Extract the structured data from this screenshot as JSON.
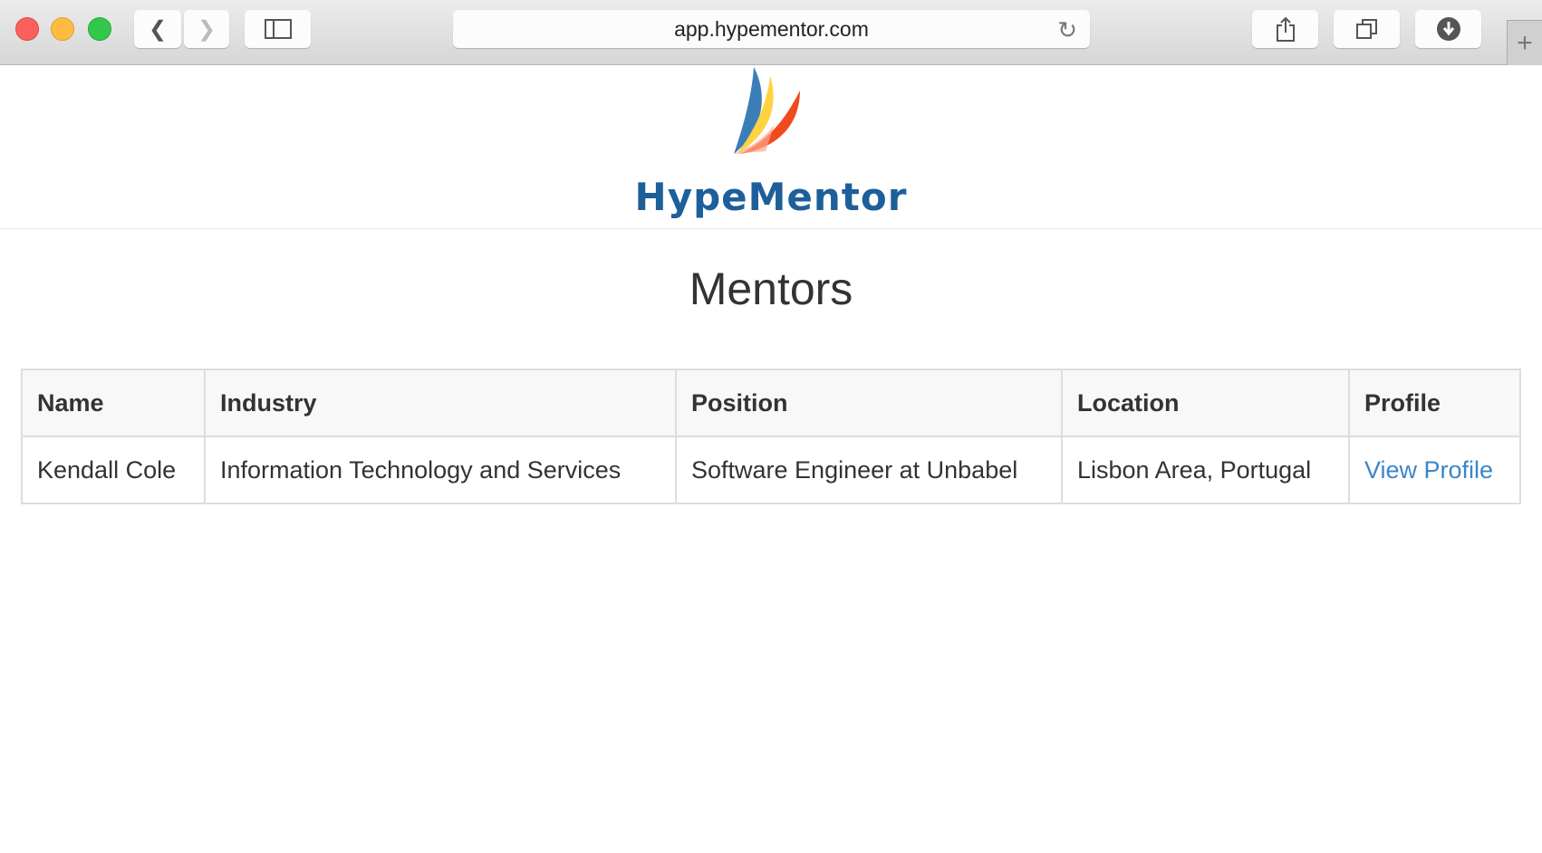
{
  "browser": {
    "url": "app.hypementor.com",
    "traffic_lights": [
      "#fc605c",
      "#fdbc40",
      "#34c84a"
    ]
  },
  "header": {
    "brand": "HypeMentor",
    "brand_color": "#1d5f9a"
  },
  "page": {
    "title": "Mentors"
  },
  "table": {
    "columns": [
      "Name",
      "Industry",
      "Position",
      "Location",
      "Profile"
    ],
    "rows": [
      {
        "name": "Kendall Cole",
        "industry": "Information Technology and Services",
        "position": "Software Engineer at Unbabel",
        "location": "Lisbon Area, Portugal",
        "profile": "View Profile"
      }
    ]
  },
  "link_color": "#3a87c8"
}
